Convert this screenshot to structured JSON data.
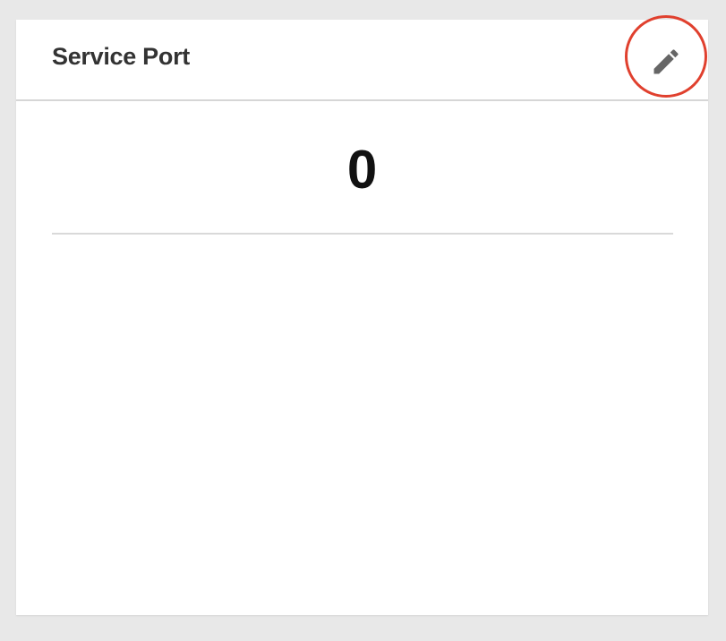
{
  "card": {
    "title": "Service Port",
    "value": "0"
  },
  "icons": {
    "edit": "pencil-icon"
  },
  "colors": {
    "highlight_ring": "#e0402e",
    "icon": "#666666",
    "title": "#333333"
  }
}
